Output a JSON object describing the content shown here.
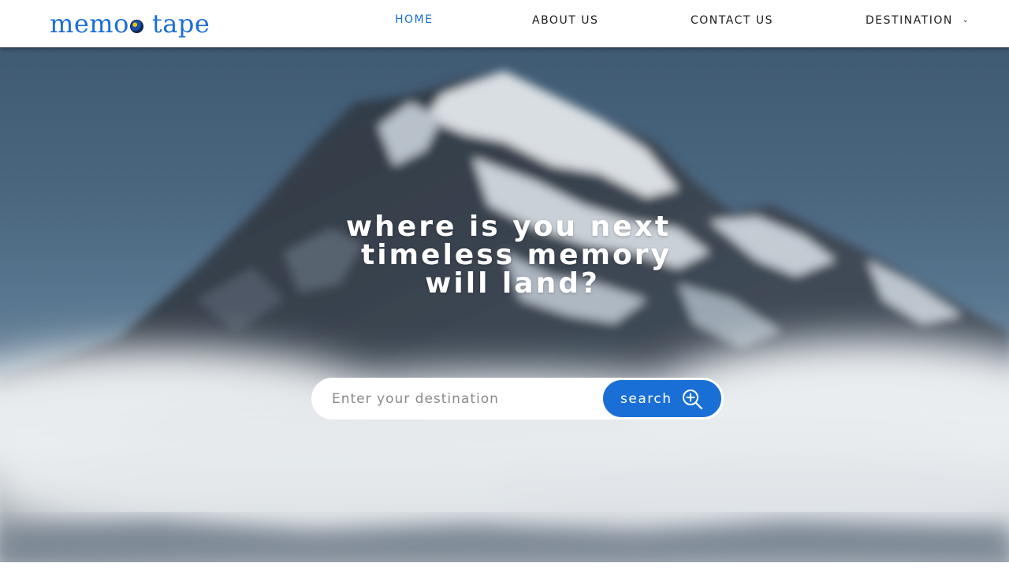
{
  "brand": {
    "word1": "memo",
    "word2": "tape",
    "globe_icon": "globe-icon",
    "color": "#1a6fd6"
  },
  "nav": {
    "home": "HOME",
    "about": "ABOUT US",
    "contact": "CONTACT US",
    "destination": "DESTINATION",
    "destination_icon": "chevron-down-icon",
    "active": "HOME"
  },
  "hero": {
    "headline_line1": "where is you next",
    "headline_line2": "timeless memory",
    "headline_line3": "will land?",
    "background": "snowy mountain peak with clouds"
  },
  "search": {
    "placeholder": "Enter your destination",
    "value": "",
    "button_label": "search",
    "button_icon": "zoom-in-icon",
    "button_color": "#1a6fd6"
  }
}
